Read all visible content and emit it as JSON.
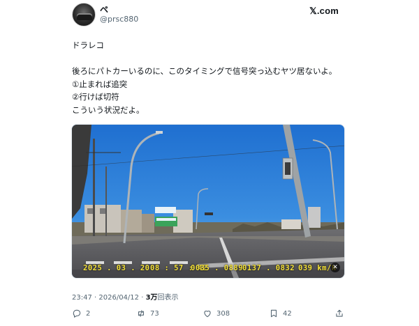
{
  "author": {
    "display_name": "ペ",
    "handle": "@prsc880",
    "avatar_icon": "car-avatar-icon"
  },
  "brand": {
    "label": "𝕏.com"
  },
  "tweet": {
    "lines": [
      "ドラレコ",
      "",
      "後ろにパトカーいるのに、このタイミングで信号突っ込むヤツ居ないよ。",
      "①止まれば追突",
      "②行けば切符",
      "こういう状況だよ。"
    ]
  },
  "media": {
    "osd_date": "2025 . 03 . 20",
    "osd_time": "08 : 57 : 42",
    "osd_val1": "0035 . 0889",
    "osd_val2": "0137 . 0832",
    "osd_speed": "039 km/h",
    "mute_icon": "mute-icon"
  },
  "meta": {
    "time": "23:47",
    "sep1": " · ",
    "date": "2026/04/12",
    "sep2": " · ",
    "views_count": "3万",
    "views_label": "回表示"
  },
  "actions": {
    "reply_count": "2",
    "retweet_count": "73",
    "like_count": "308",
    "bookmark_count": "42"
  },
  "colors": {
    "text_primary": "#0f1419",
    "text_secondary": "#536471",
    "osd_yellow": "#f5e23a"
  }
}
